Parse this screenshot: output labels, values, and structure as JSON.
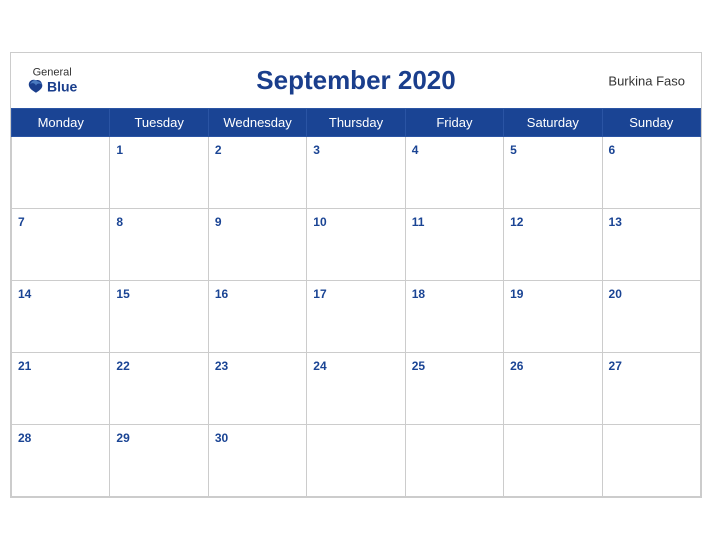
{
  "header": {
    "title": "September 2020",
    "country": "Burkina Faso",
    "logo_general": "General",
    "logo_blue": "Blue"
  },
  "weekdays": [
    "Monday",
    "Tuesday",
    "Wednesday",
    "Thursday",
    "Friday",
    "Saturday",
    "Sunday"
  ],
  "weeks": [
    [
      null,
      1,
      2,
      3,
      4,
      5,
      6
    ],
    [
      7,
      8,
      9,
      10,
      11,
      12,
      13
    ],
    [
      14,
      15,
      16,
      17,
      18,
      19,
      20
    ],
    [
      21,
      22,
      23,
      24,
      25,
      26,
      27
    ],
    [
      28,
      29,
      30,
      null,
      null,
      null,
      null
    ]
  ]
}
